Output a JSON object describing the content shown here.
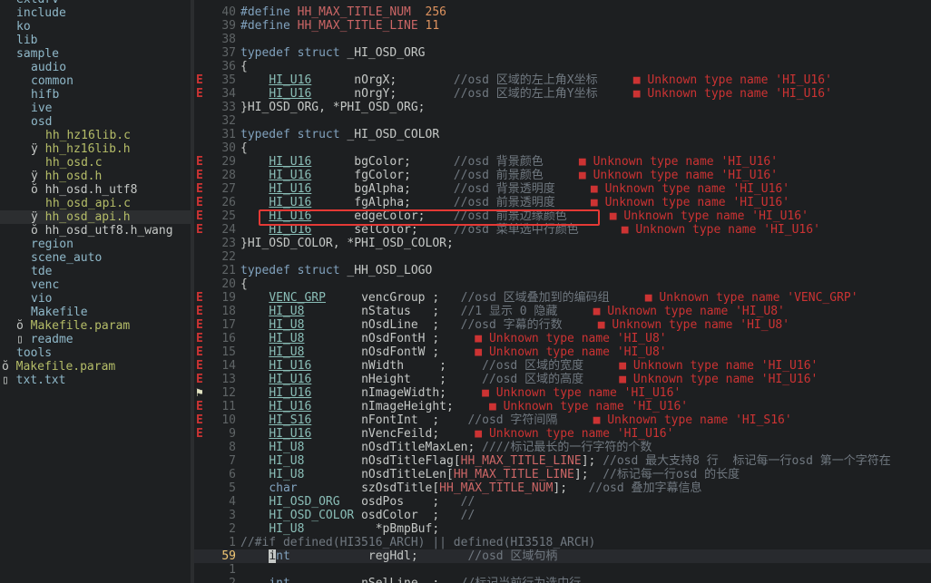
{
  "file_tree": [
    {
      "indent": 1,
      "prefix": "",
      "name": "extdrv",
      "kind": "dir"
    },
    {
      "indent": 1,
      "prefix": "",
      "name": "include",
      "kind": "dir"
    },
    {
      "indent": 1,
      "prefix": "",
      "name": "ko",
      "kind": "dir"
    },
    {
      "indent": 1,
      "prefix": "",
      "name": "lib",
      "kind": "dir"
    },
    {
      "indent": 1,
      "prefix": "",
      "name": "sample",
      "kind": "dir"
    },
    {
      "indent": 2,
      "prefix": "",
      "name": "audio",
      "kind": "dir"
    },
    {
      "indent": 2,
      "prefix": "",
      "name": "common",
      "kind": "dir"
    },
    {
      "indent": 2,
      "prefix": "",
      "name": "hifb",
      "kind": "dir"
    },
    {
      "indent": 2,
      "prefix": "",
      "name": "ive",
      "kind": "dir"
    },
    {
      "indent": 2,
      "prefix": "",
      "name": "osd",
      "kind": "dir"
    },
    {
      "indent": 3,
      "prefix": "",
      "name": "hh_hz16lib.c",
      "kind": "file"
    },
    {
      "indent": 2,
      "prefix": "ÿ ",
      "name": "hh_hz16lib.h",
      "kind": "file"
    },
    {
      "indent": 3,
      "prefix": "",
      "name": "hh_osd.c",
      "kind": "file"
    },
    {
      "indent": 2,
      "prefix": "ÿ ",
      "name": "hh_osd.h",
      "kind": "file"
    },
    {
      "indent": 2,
      "prefix": "ŏ ",
      "name": "hh_osd.h_utf8",
      "kind": "plain"
    },
    {
      "indent": 3,
      "prefix": "",
      "name": "hh_osd_api.c",
      "kind": "file"
    },
    {
      "indent": 2,
      "prefix": "ÿ ",
      "name": "hh_osd_api.h",
      "kind": "file",
      "selected": true
    },
    {
      "indent": 2,
      "prefix": "ŏ ",
      "name": "hh_osd_utf8.h_wang",
      "kind": "plain"
    },
    {
      "indent": 2,
      "prefix": "",
      "name": "region",
      "kind": "dir"
    },
    {
      "indent": 2,
      "prefix": "",
      "name": "scene_auto",
      "kind": "dir"
    },
    {
      "indent": 2,
      "prefix": "",
      "name": "tde",
      "kind": "dir"
    },
    {
      "indent": 2,
      "prefix": "",
      "name": "venc",
      "kind": "dir"
    },
    {
      "indent": 2,
      "prefix": "",
      "name": "vio",
      "kind": "dir"
    },
    {
      "indent": 2,
      "prefix": "",
      "name": "Makefile",
      "kind": "dir"
    },
    {
      "indent": 1,
      "prefix": "ŏ ",
      "name": "Makefile.param",
      "kind": "file"
    },
    {
      "indent": 1,
      "prefix": "▯ ",
      "name": "readme",
      "kind": "dir"
    },
    {
      "indent": 1,
      "prefix": "",
      "name": "tools",
      "kind": "dir"
    },
    {
      "indent": 0,
      "prefix": "ŏ ",
      "name": "Makefile.param",
      "kind": "file"
    },
    {
      "indent": 0,
      "prefix": "▯ ",
      "name": "txt.txt",
      "kind": "dir"
    }
  ],
  "editor": {
    "lines": [
      {
        "sign": "",
        "num": "40",
        "segs": [
          [
            "kw",
            "#define "
          ],
          [
            "mac",
            "HH_MAX_TITLE_NUM"
          ],
          [
            "",
            "  "
          ],
          [
            "num",
            "256"
          ]
        ]
      },
      {
        "sign": "",
        "num": "39",
        "segs": [
          [
            "kw",
            "#define "
          ],
          [
            "mac",
            "HH_MAX_TITLE_LINE"
          ],
          [
            "",
            ""
          ],
          [
            "num",
            " 11"
          ]
        ]
      },
      {
        "sign": "",
        "num": "38",
        "segs": []
      },
      {
        "sign": "",
        "num": "37",
        "segs": [
          [
            "kw",
            "typedef struct"
          ],
          [
            "",
            " _HI_OSD_ORG"
          ]
        ]
      },
      {
        "sign": "",
        "num": "36",
        "segs": [
          [
            "",
            "{"
          ]
        ]
      },
      {
        "sign": "E",
        "num": "35",
        "segs": [
          [
            "",
            "    "
          ],
          [
            "ty",
            "HI_U16"
          ],
          [
            "",
            "      nOrgX;        "
          ],
          [
            "cmt",
            "//osd 区域的左上角X坐标     "
          ],
          [
            "err",
            "■ Unknown type name 'HI_U16'"
          ]
        ]
      },
      {
        "sign": "E",
        "num": "34",
        "segs": [
          [
            "",
            "    "
          ],
          [
            "ty",
            "HI_U16"
          ],
          [
            "",
            "      nOrgY;        "
          ],
          [
            "cmt",
            "//osd 区域的左上角Y坐标     "
          ],
          [
            "err",
            "■ Unknown type name 'HI_U16'"
          ]
        ]
      },
      {
        "sign": "",
        "num": "33",
        "segs": [
          [
            "",
            "}HI_OSD_ORG, *PHI_OSD_ORG;"
          ]
        ]
      },
      {
        "sign": "",
        "num": "32",
        "segs": []
      },
      {
        "sign": "",
        "num": "31",
        "segs": [
          [
            "kw",
            "typedef struct"
          ],
          [
            "",
            " _HI_OSD_COLOR"
          ]
        ]
      },
      {
        "sign": "",
        "num": "30",
        "segs": [
          [
            "",
            "{"
          ]
        ]
      },
      {
        "sign": "E",
        "num": "29",
        "segs": [
          [
            "",
            "    "
          ],
          [
            "ty",
            "HI_U16"
          ],
          [
            "",
            "      bgColor;      "
          ],
          [
            "cmt",
            "//osd 背景颜色     "
          ],
          [
            "err",
            "■ Unknown type name 'HI_U16'"
          ]
        ]
      },
      {
        "sign": "E",
        "num": "28",
        "segs": [
          [
            "",
            "    "
          ],
          [
            "ty",
            "HI_U16"
          ],
          [
            "",
            "      fgColor;      "
          ],
          [
            "cmt",
            "//osd 前景颜色     "
          ],
          [
            "err",
            "■ Unknown type name 'HI_U16'"
          ]
        ]
      },
      {
        "sign": "E",
        "num": "27",
        "segs": [
          [
            "",
            "    "
          ],
          [
            "ty",
            "HI_U16"
          ],
          [
            "",
            "      bgAlpha;      "
          ],
          [
            "cmt",
            "//osd 背景透明度     "
          ],
          [
            "err",
            "■ Unknown type name 'HI_U16'"
          ]
        ]
      },
      {
        "sign": "E",
        "num": "26",
        "segs": [
          [
            "",
            "    "
          ],
          [
            "ty",
            "HI_U16"
          ],
          [
            "",
            "      fgAlpha;      "
          ],
          [
            "cmt",
            "//osd 前景透明度     "
          ],
          [
            "err",
            "■ Unknown type name 'HI_U16'"
          ]
        ]
      },
      {
        "sign": "E",
        "num": "25",
        "segs": [
          [
            "",
            "    "
          ],
          [
            "ty",
            "HI_U16"
          ],
          [
            "",
            "      edgeColor;    "
          ],
          [
            "cmt",
            "//osd 前景边缘颜色      "
          ],
          [
            "err",
            "■ Unknown type name 'HI_U16'"
          ]
        ]
      },
      {
        "sign": "E",
        "num": "24",
        "segs": [
          [
            "",
            "    "
          ],
          [
            "ty",
            "HI_U16"
          ],
          [
            "",
            "      selColor;     "
          ],
          [
            "cmt",
            "//osd 菜单选中行颜色      "
          ],
          [
            "err",
            "■ Unknown type name 'HI_U16'"
          ]
        ]
      },
      {
        "sign": "",
        "num": "23",
        "segs": [
          [
            "",
            "}HI_OSD_COLOR, *PHI_OSD_COLOR;"
          ]
        ]
      },
      {
        "sign": "",
        "num": "22",
        "segs": []
      },
      {
        "sign": "",
        "num": "21",
        "segs": [
          [
            "kw",
            "typedef struct"
          ],
          [
            "",
            " _HH_OSD_LOGO"
          ]
        ]
      },
      {
        "sign": "",
        "num": "20",
        "segs": [
          [
            "",
            "{"
          ]
        ]
      },
      {
        "sign": "E",
        "num": "19",
        "segs": [
          [
            "",
            "    "
          ],
          [
            "ty",
            "VENC_GRP"
          ],
          [
            "",
            "     vencGroup ;   "
          ],
          [
            "cmt",
            "//osd 区域叠加到的编码组     "
          ],
          [
            "err",
            "■ Unknown type name 'VENC_GRP'"
          ]
        ]
      },
      {
        "sign": "E",
        "num": "18",
        "segs": [
          [
            "",
            "    "
          ],
          [
            "ty",
            "HI_U8"
          ],
          [
            "",
            "        nStatus   ;   "
          ],
          [
            "cmt",
            "//1 显示 0 隐藏     "
          ],
          [
            "err",
            "■ Unknown type name 'HI_U8'"
          ]
        ]
      },
      {
        "sign": "E",
        "num": "17",
        "segs": [
          [
            "",
            "    "
          ],
          [
            "ty",
            "HI_U8"
          ],
          [
            "",
            "        nOsdLine  ;   "
          ],
          [
            "cmt",
            "//osd 字幕的行数     "
          ],
          [
            "err",
            "■ Unknown type name 'HI_U8'"
          ]
        ]
      },
      {
        "sign": "E",
        "num": "16",
        "segs": [
          [
            "",
            "    "
          ],
          [
            "ty",
            "HI_U8"
          ],
          [
            "",
            "        nOsdFontH ;     "
          ],
          [
            "err",
            "■ Unknown type name 'HI_U8'"
          ]
        ]
      },
      {
        "sign": "E",
        "num": "15",
        "segs": [
          [
            "",
            "    "
          ],
          [
            "ty",
            "HI_U8"
          ],
          [
            "",
            "        nOsdFontW ;     "
          ],
          [
            "err",
            "■ Unknown type name 'HI_U8'"
          ]
        ]
      },
      {
        "sign": "E",
        "num": "14",
        "segs": [
          [
            "",
            "    "
          ],
          [
            "ty",
            "HI_U16"
          ],
          [
            "",
            "       nWidth     ;     "
          ],
          [
            "cmt",
            "//osd 区域的宽度     "
          ],
          [
            "err",
            "■ Unknown type name 'HI_U16'"
          ]
        ]
      },
      {
        "sign": "E",
        "num": "13",
        "segs": [
          [
            "",
            "    "
          ],
          [
            "ty",
            "HI_U16"
          ],
          [
            "",
            "       nHeight    ;     "
          ],
          [
            "cmt",
            "//osd 区域的高度     "
          ],
          [
            "err",
            "■ Unknown type name 'HI_U16'"
          ]
        ]
      },
      {
        "sign": "⚑",
        "num": "12",
        "segs": [
          [
            "",
            "    "
          ],
          [
            "ty",
            "HI_U16"
          ],
          [
            "",
            "       nImageWidth;     "
          ],
          [
            "err",
            "■ Unknown type name 'HI_U16'"
          ]
        ]
      },
      {
        "sign": "E",
        "num": "11",
        "segs": [
          [
            "",
            "    "
          ],
          [
            "ty",
            "HI_U16"
          ],
          [
            "",
            "       nImageHeight;     "
          ],
          [
            "err",
            "■ Unknown type name 'HI_U16'"
          ]
        ]
      },
      {
        "sign": "E",
        "num": "10",
        "segs": [
          [
            "",
            "    "
          ],
          [
            "ty",
            "HI_S16"
          ],
          [
            "",
            "       nFontInt  ;    "
          ],
          [
            "cmt",
            "//osd 字符间隔     "
          ],
          [
            "err",
            "■ Unknown type name 'HI_S16'"
          ]
        ]
      },
      {
        "sign": "E",
        "num": "9",
        "segs": [
          [
            "",
            "    "
          ],
          [
            "ty",
            "HI_U16"
          ],
          [
            "",
            "       nVencFeild;     "
          ],
          [
            "err",
            "■ Unknown type name 'HI_U16'"
          ]
        ]
      },
      {
        "sign": "",
        "num": "8",
        "segs": [
          [
            "",
            "    "
          ],
          [
            "tyn",
            "HI_U8"
          ],
          [
            "",
            "        nOsdTitleMaxLen; "
          ],
          [
            "cmt",
            "////标记最长的一行字符的个数"
          ]
        ]
      },
      {
        "sign": "",
        "num": "7",
        "segs": [
          [
            "",
            "    "
          ],
          [
            "tyn",
            "HI_U8"
          ],
          [
            "",
            "        nOsdTitleFlag["
          ],
          [
            "mac",
            "HH_MAX_TITLE_LINE"
          ],
          [
            "",
            "]; "
          ],
          [
            "cmt",
            "//osd 最大支持8 行  标记每一行osd 第一个字符在"
          ]
        ]
      },
      {
        "sign": "",
        "num": "6",
        "segs": [
          [
            "",
            "    "
          ],
          [
            "tyn",
            "HI_U8"
          ],
          [
            "",
            "        nOsdTitleLen["
          ],
          [
            "mac",
            "HH_MAX_TITLE_LINE"
          ],
          [
            "",
            "];  "
          ],
          [
            "cmt",
            "//标记每一行osd 的长度"
          ]
        ]
      },
      {
        "sign": "",
        "num": "5",
        "segs": [
          [
            "",
            "    "
          ],
          [
            "kw",
            "char"
          ],
          [
            "",
            "         szOsdTitle["
          ],
          [
            "mac",
            "HH_MAX_TITLE_NUM"
          ],
          [
            "",
            "];   "
          ],
          [
            "cmt",
            "//osd 叠加字幕信息"
          ]
        ]
      },
      {
        "sign": "",
        "num": "4",
        "segs": [
          [
            "",
            "    "
          ],
          [
            "tyn",
            "HI_OSD_ORG"
          ],
          [
            "",
            "   osdPos    ;   "
          ],
          [
            "cmt",
            "//"
          ]
        ]
      },
      {
        "sign": "",
        "num": "3",
        "segs": [
          [
            "",
            "    "
          ],
          [
            "tyn",
            "HI_OSD_COLOR"
          ],
          [
            "",
            " osdColor  ;   "
          ],
          [
            "cmt",
            "//"
          ]
        ]
      },
      {
        "sign": "",
        "num": "2",
        "segs": [
          [
            "",
            "    "
          ],
          [
            "tyn",
            "HI_U8"
          ],
          [
            "",
            "          *pBmpBuf;"
          ]
        ]
      },
      {
        "sign": "",
        "num": "1",
        "segs": [
          [
            "cmt",
            "//#if defined(HI3516_ARCH) || defined(HI3518_ARCH)"
          ]
        ]
      },
      {
        "sign": "",
        "num": "59",
        "current": true,
        "segs": [
          [
            "",
            "    "
          ],
          [
            "cursor",
            "i"
          ],
          [
            "kw",
            "nt"
          ],
          [
            "",
            "           regHdl;       "
          ],
          [
            "cmt",
            "//osd 区域句柄"
          ]
        ]
      },
      {
        "sign": "",
        "num": "1",
        "segs": []
      },
      {
        "sign": "",
        "num": "2",
        "segs": [
          [
            "",
            "    "
          ],
          [
            "kw",
            "int"
          ],
          [
            "",
            "          nSelLine  ;   "
          ],
          [
            "cmt",
            "//标记当前行为选中行"
          ]
        ]
      }
    ]
  }
}
